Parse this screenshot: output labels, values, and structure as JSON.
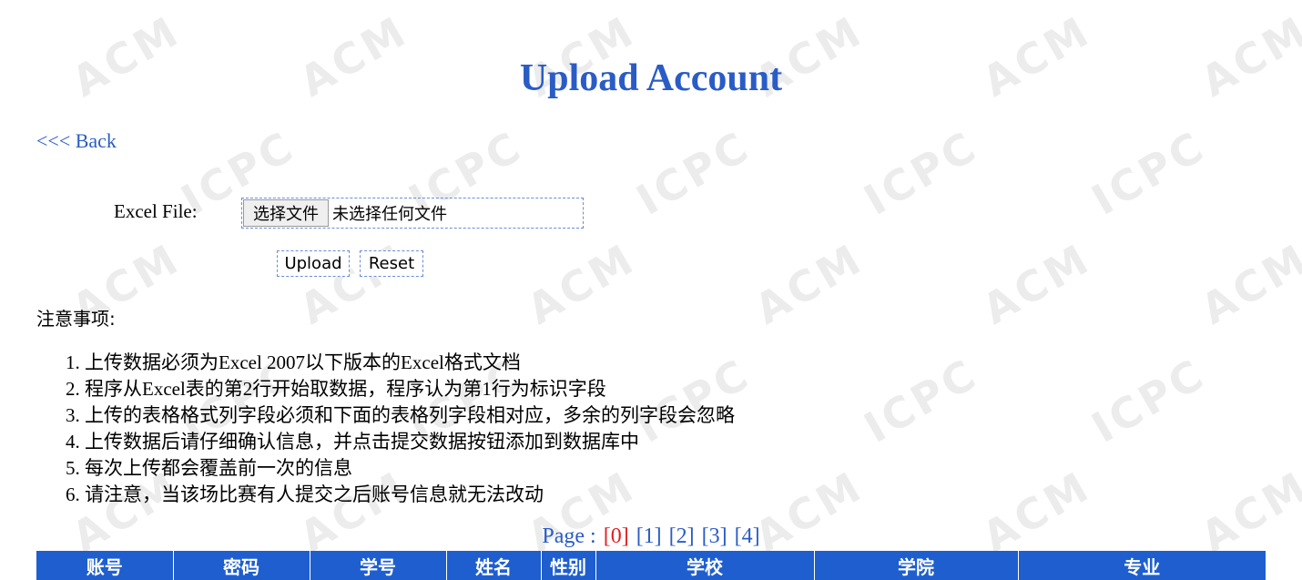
{
  "title": "Upload Account",
  "back_link": "<<< Back",
  "upload_form": {
    "file_label": "Excel File:",
    "choose_button": "选择文件",
    "file_status": "未选择任何文件",
    "upload_button": "Upload",
    "reset_button": "Reset"
  },
  "notes": {
    "heading": "注意事项:",
    "items": [
      "1. 上传数据必须为Excel 2007以下版本的Excel格式文档",
      "2. 程序从Excel表的第2行开始取数据，程序认为第1行为标识字段",
      "3. 上传的表格格式列字段必须和下面的表格列字段相对应，多余的列字段会忽略",
      "4. 上传数据后请仔细确认信息，并点击提交数据按钮添加到数据库中",
      "5. 每次上传都会覆盖前一次的信息",
      "6. 请注意，当该场比赛有人提交之后账号信息就无法改动"
    ]
  },
  "pagination": {
    "label": "Page :",
    "pages": [
      "[0]",
      "[1]",
      "[2]",
      "[3]",
      "[4]"
    ],
    "current_index": 0
  },
  "table": {
    "headers": [
      "账号",
      "密码",
      "学号",
      "姓名",
      "性别",
      "学校",
      "学院",
      "专业"
    ]
  },
  "watermark": {
    "texts": [
      "ACM",
      "ICPC"
    ],
    "color": "#ececec"
  },
  "colors": {
    "accent": "#2a5cc6",
    "table_header": "#1e5ecf",
    "active_page": "#e02020"
  }
}
